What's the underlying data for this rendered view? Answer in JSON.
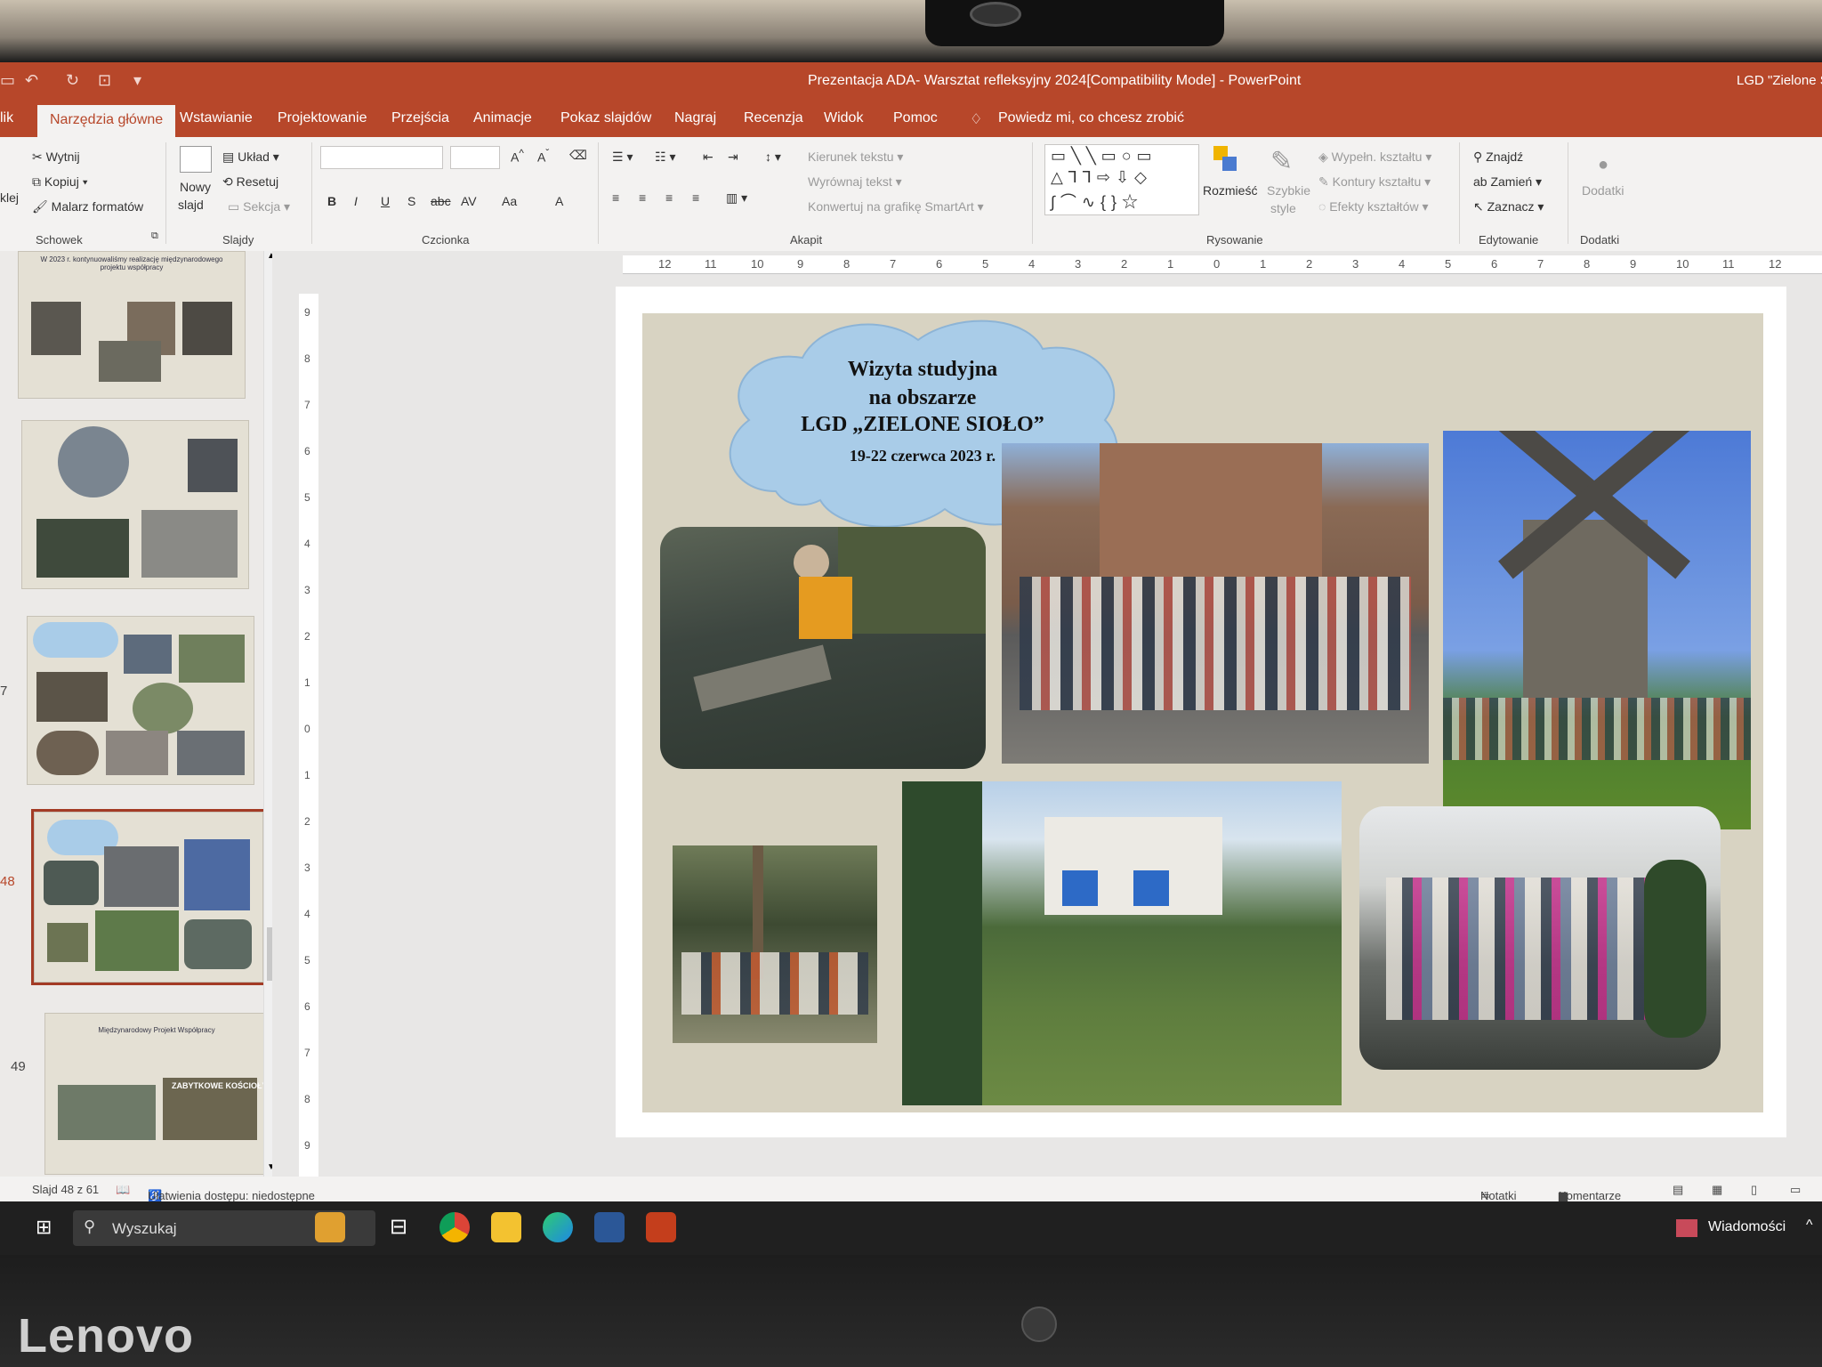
{
  "window": {
    "title": "Prezentacja ADA- Warsztat refleksyjny 2024[Compatibility Mode]  -  PowerPoint",
    "account": "LGD \"Zielone Si"
  },
  "tabs": [
    {
      "label": "lik"
    },
    {
      "label": "Narzędzia główne",
      "active": true
    },
    {
      "label": "Wstawianie"
    },
    {
      "label": "Projektowanie"
    },
    {
      "label": "Przejścia"
    },
    {
      "label": "Animacje"
    },
    {
      "label": "Pokaz slajdów"
    },
    {
      "label": "Nagraj"
    },
    {
      "label": "Recenzja"
    },
    {
      "label": "Widok"
    },
    {
      "label": "Pomoc"
    }
  ],
  "tell_me": "Powiedz mi, co chcesz zrobić",
  "ribbon": {
    "clipboard": {
      "paste": "klej",
      "cut": "Wytnij",
      "copy": "Kopiuj",
      "painter": "Malarz formatów",
      "group": "Schowek"
    },
    "slides": {
      "new_slide_1": "Nowy",
      "new_slide_2": "slajd",
      "layout": "Układ",
      "reset": "Resetuj",
      "section": "Sekcja",
      "group": "Slajdy"
    },
    "font": {
      "group": "Czcionka",
      "bold": "B",
      "italic": "I",
      "underline": "U",
      "shadow": "S",
      "strike": "abc",
      "spacing": "AV",
      "case": "Aa",
      "color": "A"
    },
    "paragraph": {
      "direction": "Kierunek tekstu",
      "align": "Wyrównaj tekst",
      "smartart": "Konwertuj na grafikę SmartArt",
      "group": "Akapit"
    },
    "drawing": {
      "arrange": "Rozmieść",
      "quick_1": "Szybkie",
      "quick_2": "style",
      "fill": "Wypełn. kształtu",
      "outline": "Kontury kształtu",
      "effects": "Efekty kształtów",
      "group": "Rysowanie"
    },
    "editing": {
      "find": "Znajdź",
      "replace": "Zamień",
      "select": "Zaznacz",
      "group": "Edytowanie"
    },
    "addins": {
      "label": "Dodatki",
      "group": "Dodatki"
    }
  },
  "ruler": {
    "h_ticks": [
      "12",
      "11",
      "10",
      "9",
      "8",
      "7",
      "6",
      "5",
      "4",
      "3",
      "2",
      "1",
      "0",
      "1",
      "2",
      "3",
      "4",
      "5",
      "6",
      "7",
      "8",
      "9",
      "10",
      "11",
      "12"
    ],
    "v_ticks": [
      "9",
      "8",
      "7",
      "6",
      "5",
      "4",
      "3",
      "2",
      "1",
      "0",
      "1",
      "2",
      "3",
      "4",
      "5",
      "6",
      "7",
      "8",
      "9"
    ]
  },
  "thumbnails": [
    {
      "number": "",
      "caption": "W 2023 r. kontynuowaliśmy realizację międzynarodowego projektu współpracy"
    },
    {
      "number": ""
    },
    {
      "number": "7"
    },
    {
      "number": "48",
      "selected": true
    },
    {
      "number": "49",
      "caption": "Międzynarodowy Projekt Współpracy",
      "badge": "ZABYTKOWE KOŚCIOŁY"
    }
  ],
  "slide": {
    "heading_1": "Wizyta studyjna",
    "heading_2": "na obszarze",
    "heading_3": "LGD „ZIELONE SIOŁO”",
    "date": "19-22 czerwca 2023 r."
  },
  "status": {
    "slide_counter": "Slajd 48 z 61",
    "accessibility": "Ułatwienia dostępu: niedostępne",
    "notes": "Notatki",
    "comments": "Komentarze"
  },
  "taskbar": {
    "search": "Wyszukaj",
    "news": "Wiadomości"
  },
  "device": {
    "brand": "Lenovo"
  },
  "colors": {
    "accent": "#b7472a",
    "cloud": "#a9cce8",
    "slide_bg": "#d8d3c2"
  }
}
